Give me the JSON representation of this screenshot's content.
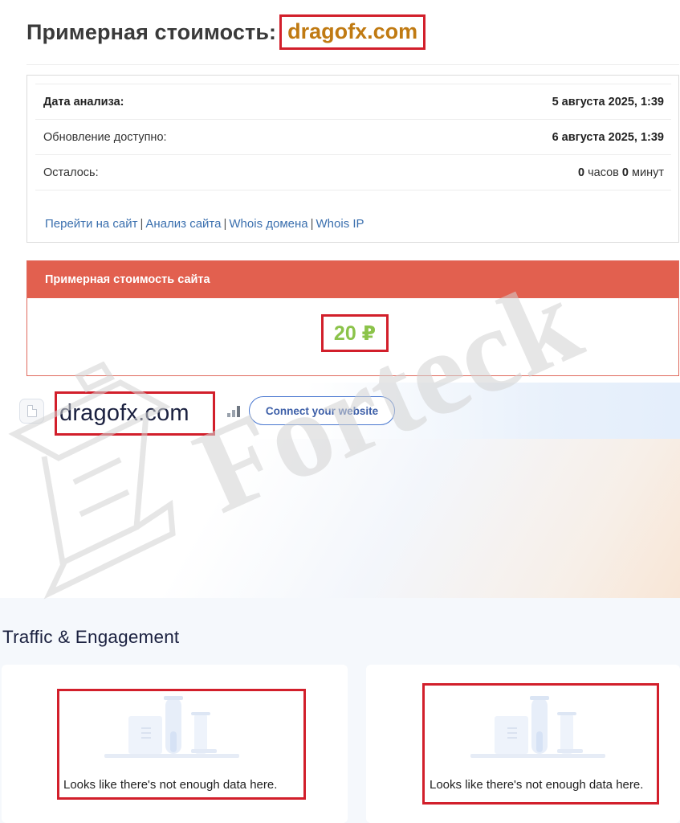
{
  "header": {
    "title": "Примерная стоимость:",
    "domain": "dragofx.com"
  },
  "info": {
    "rows": [
      {
        "label": "Дата анализа:",
        "value": "5 августа 2025, 1:39"
      },
      {
        "label": "Обновление доступно:",
        "value": "6 августа 2025, 1:39"
      }
    ],
    "remaining": {
      "label": "Осталось:",
      "hours": "0",
      "hours_unit": "часов",
      "minutes": "0",
      "minutes_unit": "минут"
    },
    "links": [
      "Перейти на сайт",
      "Анализ сайта",
      "Whois домена",
      "Whois IP"
    ],
    "separator": "|"
  },
  "estimate": {
    "header": "Примерная стоимость сайта",
    "value": "20 ₽"
  },
  "site_profile": {
    "domain": "dragofx.com",
    "favicon_icon": "document-icon",
    "rank_icon": "bar-chart-icon",
    "connect_label": "Connect your website"
  },
  "traffic": {
    "title": "Traffic & Engagement",
    "cards": [
      {
        "empty_message": "Looks like there's not enough data here.",
        "illustration": "lab-flasks-illustration"
      },
      {
        "empty_message": "Looks like there's not enough data here.",
        "illustration": "lab-flasks-illustration"
      }
    ]
  },
  "watermark": {
    "text": "Forteck",
    "color": "#d9d9d9"
  },
  "colors": {
    "title_domain": "#c07a12",
    "highlight_border": "#d21f2b",
    "estimate_header_bg": "#e2604f",
    "estimate_value": "#8bc34a",
    "link": "#3a6fae",
    "connect_button": "#4a78d0"
  }
}
